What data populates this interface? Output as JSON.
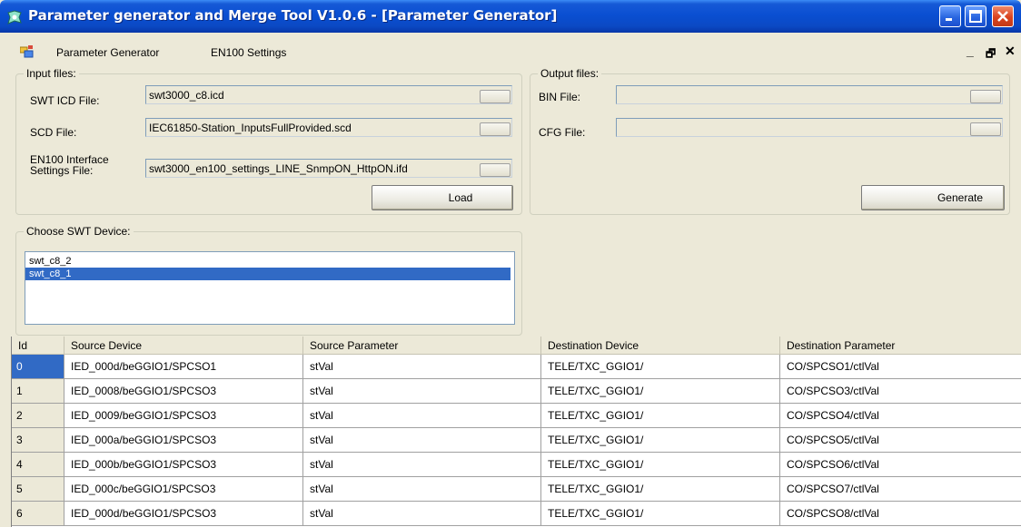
{
  "window": {
    "title": "Parameter generator and Merge Tool V1.0.6 - [Parameter Generator]"
  },
  "menu": {
    "items": [
      "Parameter Generator",
      "EN100 Settings"
    ],
    "mdi_controls": [
      "_",
      "🗗",
      "✕"
    ]
  },
  "input_files": {
    "group_label": "Input files:",
    "swt_icd": {
      "label": "SWT ICD File:",
      "value": "swt3000_c8.icd"
    },
    "scd": {
      "label": "SCD File:",
      "value": "IEC61850-Station_InputsFullProvided.scd"
    },
    "en100": {
      "label_line1": "EN100 Interface",
      "label_line2": "Settings File:",
      "value": "swt3000_en100_settings_LINE_SnmpON_HttpON.ifd"
    },
    "load_button": "Load"
  },
  "output_files": {
    "group_label": "Output files:",
    "bin": {
      "label": "BIN File:",
      "value": ""
    },
    "cfg": {
      "label": "CFG File:",
      "value": ""
    },
    "generate_button": "Generate"
  },
  "device_chooser": {
    "group_label": "Choose SWT Device:",
    "items": [
      {
        "label": "swt_c8_2",
        "selected": false
      },
      {
        "label": "swt_c8_1",
        "selected": true
      }
    ]
  },
  "grid": {
    "columns": [
      "Id",
      "Source Device",
      "Source Parameter",
      "Destination Device",
      "Destination Parameter"
    ],
    "rows": [
      [
        "0",
        "IED_000d/beGGIO1/SPCSO1",
        "stVal",
        "TELE/TXC_GGIO1/",
        "CO/SPCSO1/ctlVal"
      ],
      [
        "1",
        "IED_0008/beGGIO1/SPCSO3",
        "stVal",
        "TELE/TXC_GGIO1/",
        "CO/SPCSO3/ctlVal"
      ],
      [
        "2",
        "IED_0009/beGGIO1/SPCSO3",
        "stVal",
        "TELE/TXC_GGIO1/",
        "CO/SPCSO4/ctlVal"
      ],
      [
        "3",
        "IED_000a/beGGIO1/SPCSO3",
        "stVal",
        "TELE/TXC_GGIO1/",
        "CO/SPCSO5/ctlVal"
      ],
      [
        "4",
        "IED_000b/beGGIO1/SPCSO3",
        "stVal",
        "TELE/TXC_GGIO1/",
        "CO/SPCSO6/ctlVal"
      ],
      [
        "5",
        "IED_000c/beGGIO1/SPCSO3",
        "stVal",
        "TELE/TXC_GGIO1/",
        "CO/SPCSO7/ctlVal"
      ],
      [
        "6",
        "IED_000d/beGGIO1/SPCSO3",
        "stVal",
        "TELE/TXC_GGIO1/",
        "CO/SPCSO8/ctlVal"
      ]
    ],
    "selected_row": 0
  },
  "colors": {
    "titlebar": "#0a4fd2",
    "selection": "#316ac5",
    "face": "#ece9d8"
  },
  "icons": [
    "app-icon",
    "minimize-icon",
    "restore-icon",
    "close-icon",
    "menu-app-icon"
  ]
}
